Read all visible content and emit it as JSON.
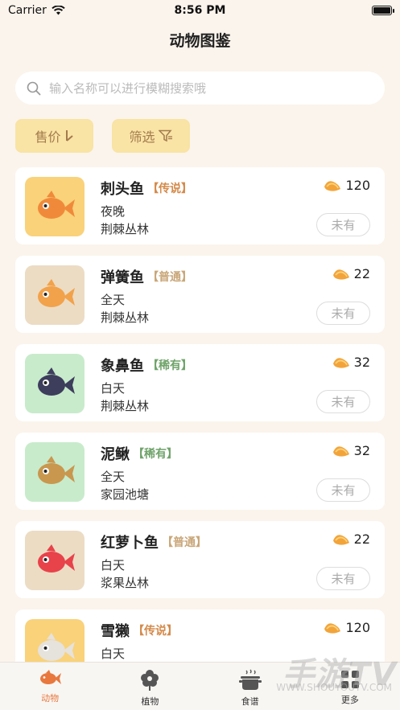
{
  "status": {
    "carrier": "Carrier",
    "time": "8:56 PM"
  },
  "title": "动物图鉴",
  "search": {
    "placeholder": "输入名称可以进行模糊搜索哦",
    "value": ""
  },
  "filters": [
    {
      "label": "售价",
      "icon": "sort-down-icon"
    },
    {
      "label": "筛选",
      "icon": "funnel-icon"
    }
  ],
  "cards": [
    {
      "name": "刺头鱼",
      "tag": "【传说】",
      "tag_color": "#d48a4a",
      "time": "夜晚",
      "place": "荆棘丛林",
      "price": "120",
      "status": "未有",
      "thumb_bg": "#f9d27a",
      "fish_color": "#f08a3a"
    },
    {
      "name": "弹簧鱼",
      "tag": "【普通】",
      "tag_color": "#c9a678",
      "time": "全天",
      "place": "荆棘丛林",
      "price": "22",
      "status": "未有",
      "thumb_bg": "#ecdcc4",
      "fish_color": "#f2a24a"
    },
    {
      "name": "象鼻鱼",
      "tag": "【稀有】",
      "tag_color": "#6fa36a",
      "time": "白天",
      "place": "荆棘丛林",
      "price": "32",
      "status": "未有",
      "thumb_bg": "#c8ebcc",
      "fish_color": "#3d3d5c"
    },
    {
      "name": "泥鳅",
      "tag": "【稀有】",
      "tag_color": "#6fa36a",
      "time": "全天",
      "place": "家园池塘",
      "price": "32",
      "status": "未有",
      "thumb_bg": "#c8ebcc",
      "fish_color": "#c9974e"
    },
    {
      "name": "红萝卜鱼",
      "tag": "【普通】",
      "tag_color": "#c9a678",
      "time": "白天",
      "place": "浆果丛林",
      "price": "22",
      "status": "未有",
      "thumb_bg": "#ecdcc4",
      "fish_color": "#e8424a"
    },
    {
      "name": "雪獭",
      "tag": "【传说】",
      "tag_color": "#d48a4a",
      "time": "白天",
      "place": "",
      "price": "120",
      "status": "",
      "thumb_bg": "#f9d27a",
      "fish_color": "#e6e2dc"
    }
  ],
  "tabs": [
    {
      "label": "动物",
      "icon": "fish-icon",
      "active": true
    },
    {
      "label": "植物",
      "icon": "flower-icon",
      "active": false
    },
    {
      "label": "食谱",
      "icon": "cooking-pot-icon",
      "active": false
    },
    {
      "label": "更多",
      "icon": "grid-icon",
      "active": false
    }
  ],
  "watermark": {
    "main": "手游TV",
    "sub": "WWW.SHOUYOUTV.COM"
  }
}
